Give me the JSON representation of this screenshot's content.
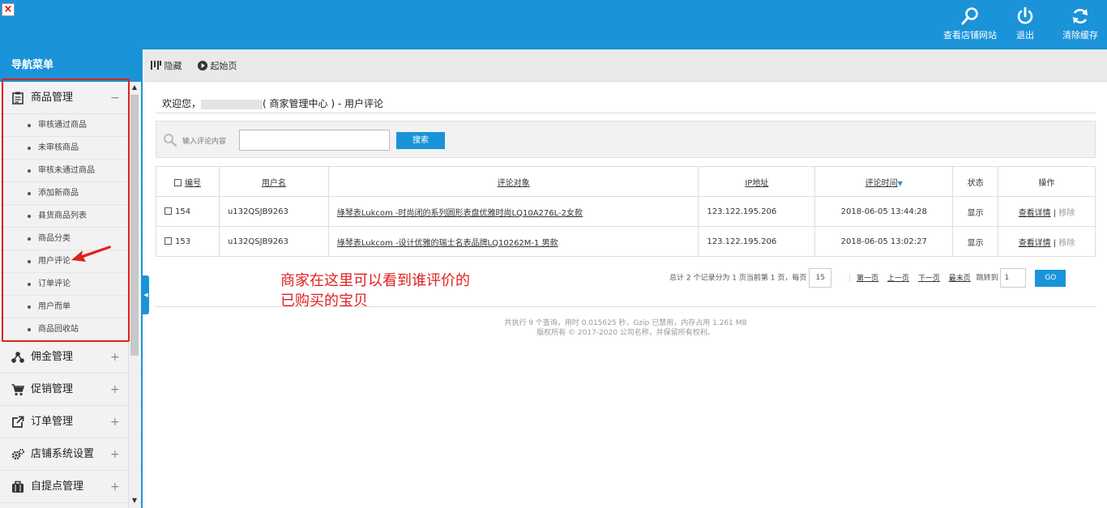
{
  "topbar": {
    "actions": [
      {
        "label": "查看店铺网站",
        "icon": "search-icon"
      },
      {
        "label": "退出",
        "icon": "power-icon"
      },
      {
        "label": "清除缓存",
        "icon": "refresh-icon"
      }
    ]
  },
  "sidebar": {
    "title": "导航菜单",
    "groups": [
      {
        "label": "商品管理",
        "icon": "clipboard-icon",
        "toggle": "−"
      },
      {
        "label": "佣金管理",
        "icon": "share-icon",
        "toggle": "+"
      },
      {
        "label": "促销管理",
        "icon": "cart-icon",
        "toggle": "+"
      },
      {
        "label": "订单管理",
        "icon": "external-icon",
        "toggle": "+"
      },
      {
        "label": "店铺系统设置",
        "icon": "gears-icon",
        "toggle": "+"
      },
      {
        "label": "自提点管理",
        "icon": "briefcase-icon",
        "toggle": "+"
      }
    ],
    "subitems": [
      "审核通过商品",
      "未审核商品",
      "审核未通过商品",
      "添加新商品",
      "县货商品列表",
      "商品分类",
      "用户评论",
      "订单评论",
      "用户而单",
      "商品回收站"
    ]
  },
  "toolbar": {
    "hide": "隐藏",
    "home": "起始页"
  },
  "main": {
    "welcome_prefix": "欢迎您，",
    "welcome_suffix": "( 商家管理中心 ) - 用户评论",
    "search_label": "输入评论内容",
    "search_value": "",
    "search_button": "搜索",
    "table": {
      "headers": [
        "编号",
        "用户名",
        "评论对象",
        "IP地址",
        "评论时间",
        "状态",
        "操作"
      ],
      "rows": [
        {
          "id": "154",
          "user": "u132QSJB9263",
          "target": "綠琴表Lukcom -时尚闭的系列圆形表盘优雅时尚LQ10A276L-2女款",
          "ip": "123.122.195.206",
          "time": "2018-06-05 13:44:28",
          "status": "显示",
          "view": "查看详情",
          "remove": "移除"
        },
        {
          "id": "153",
          "user": "u132QSJB9263",
          "target": "綠琴表Lukcom -设计优雅的瑞士名表品牌LQ10262M-1 男款",
          "ip": "123.122.195.206",
          "time": "2018-06-05 13:02:27",
          "status": "显示",
          "view": "查看详情",
          "remove": "移除"
        }
      ]
    },
    "pager": {
      "summary": "总计 2 个记录分为 1 页当前第 1 页，每页",
      "per_page": "15",
      "first": "第一页",
      "prev": "上一页",
      "next": "下一页",
      "last": "最末页",
      "jump": "跳转到",
      "page": "1",
      "go": "GO"
    },
    "annotation_line1": "商家在这里可以看到谁评价的",
    "annotation_line2": "已购买的宝贝",
    "footer_line1": "共执行 9 个查询，用时 0.015625 秒，Gzip 已禁用，内存占用 1.261 MB",
    "footer_line2": "版权所有 © 2017-2020 公司名称，并保留所有权利。"
  },
  "colors": {
    "brand": "#1a93d8",
    "annotation": "#e02020"
  }
}
